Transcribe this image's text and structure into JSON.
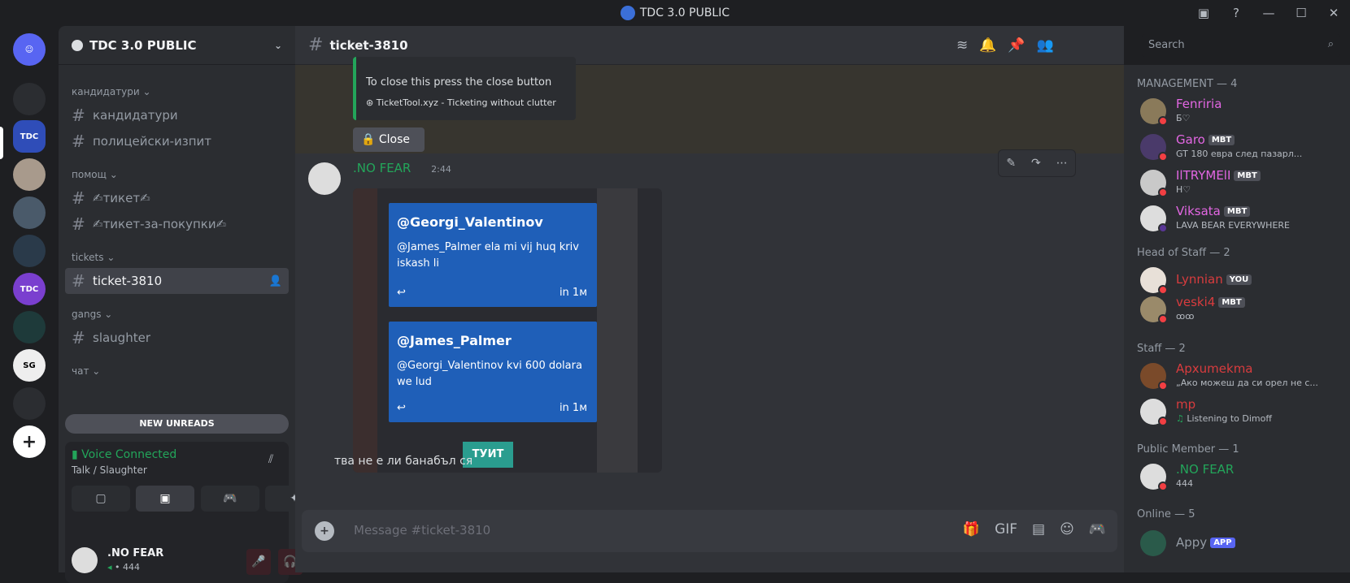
{
  "window": {
    "title": "TDC 3.0 PUBLIC"
  },
  "server": {
    "name": "TDC 3.0 PUBLIC"
  },
  "categories": {
    "candidates": "кандидатури",
    "help": "помощ",
    "tickets": "tickets",
    "gangs": "gangs",
    "chat": "чат"
  },
  "channels": {
    "candidates": "кандидатури",
    "police_exam": "полицейски-изпит",
    "ticket": "✍тикет✍",
    "ticket_purchases": "✍тикет-за-покупки✍",
    "ticket_3810": "ticket-3810",
    "slaughter": "slaughter"
  },
  "new_unreads": "NEW UNREADS",
  "voice": {
    "status": "Voice Connected",
    "location": "Talk / Slaughter"
  },
  "user": {
    "name": ".NO FEAR",
    "tag": "• 444"
  },
  "channel_header": {
    "name": "ticket-3810"
  },
  "search": {
    "placeholder": "Search"
  },
  "embed": {
    "line1": "To close this press the close button",
    "footer": "TicketTool.xyz - Ticketing without clutter",
    "close_button": "Close"
  },
  "message": {
    "author": ".NO FEAR",
    "time": "2:44",
    "text": "тва не е ли банабъл ся",
    "tweets": [
      {
        "handle": "@Georgi_Valentinov",
        "text": "@James_Palmer ela mi vij huq kriv iskash li",
        "time": "in 1м"
      },
      {
        "handle": "@James_Palmer",
        "text": "@Georgi_Valentinov kvi 600 dolara we lud",
        "time": "in 1м"
      }
    ],
    "tweet_button": "ТУИТ"
  },
  "composer": {
    "placeholder": "Message #ticket-3810"
  },
  "members": {
    "management_header": "MANAGEMENT — 4",
    "management": [
      {
        "name": "Fenriria",
        "status": "Б♡",
        "color": "#e367e3",
        "tag": ""
      },
      {
        "name": "Garo",
        "status": "GT 180 евра след пазарл...",
        "color": "#e367e3",
        "tag": "MBT"
      },
      {
        "name": "IlTRYMElI",
        "status": "H♡",
        "color": "#e367e3",
        "tag": "MBT"
      },
      {
        "name": "Viksata",
        "status": "LAVA BEAR EVERYWHERE",
        "color": "#e367e3",
        "tag": "MBT"
      }
    ],
    "head_header": "Head of Staff — 2",
    "head": [
      {
        "name": "Lynnian",
        "status": "",
        "color": "#d83c3e",
        "tag": "YOU"
      },
      {
        "name": "veski4",
        "status": "ꝏꝏ",
        "color": "#d83c3e",
        "tag": "MBT"
      }
    ],
    "staff_header": "Staff — 2",
    "staff": [
      {
        "name": "Apxumekma",
        "status": "„Ако можеш да си орел не с...",
        "color": "#d83c3e",
        "tag": ""
      },
      {
        "name": "mp",
        "status": "Listening to Dimoff",
        "color": "#d83c3e",
        "tag": ""
      }
    ],
    "public_header": "Public Member — 1",
    "public": [
      {
        "name": ".NO FEAR",
        "status": "444",
        "color": "#23a55a",
        "tag": ""
      }
    ],
    "online_header": "Online — 5",
    "online": [
      {
        "name": "Appy",
        "tag": "APP"
      }
    ]
  }
}
